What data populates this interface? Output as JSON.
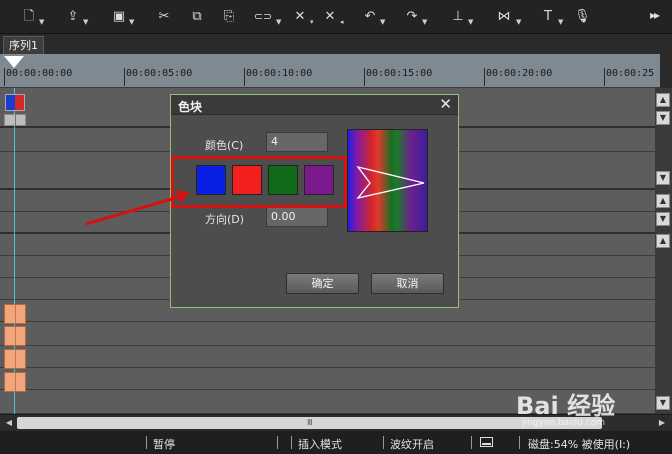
{
  "toolbar": {
    "buttons": [
      {
        "icon": "new-file-icon",
        "glyph": "🗋"
      },
      {
        "icon": "open-icon",
        "glyph": "⇪"
      },
      {
        "icon": "save-icon",
        "glyph": "▣"
      },
      {
        "icon": "cut-icon",
        "glyph": "✂"
      },
      {
        "icon": "copy-icon",
        "glyph": "⧉"
      },
      {
        "icon": "paste-icon",
        "glyph": "⎘"
      },
      {
        "icon": "link-icon",
        "glyph": "⊂⊃"
      },
      {
        "icon": "delete-icon",
        "glyph": "✕"
      },
      {
        "icon": "ripple-delete-icon",
        "glyph": "✕"
      },
      {
        "icon": "undo-icon",
        "glyph": "↶"
      },
      {
        "icon": "redo-icon",
        "glyph": "↷"
      },
      {
        "icon": "mark-icon",
        "glyph": "⊥"
      },
      {
        "icon": "trim-icon",
        "glyph": "⋈"
      },
      {
        "icon": "title-icon",
        "glyph": "T"
      },
      {
        "icon": "voiceover-icon",
        "glyph": "🎙"
      }
    ],
    "more_icon": "more-icon"
  },
  "sequence_tab": "序列1",
  "ruler": {
    "labels": [
      "00:00:00:00",
      "00:00:05:00",
      "00:00:10:00",
      "00:00:15:00",
      "00:00:20:00",
      "00:00:25"
    ]
  },
  "dialog": {
    "title": "色块",
    "color_label": "颜色(C)",
    "color_value": "4",
    "direction_label": "方向(D)",
    "direction_value": "0.00",
    "swatches": [
      "#0a1fe6",
      "#f41f1f",
      "#0f6b1a",
      "#7b1a8c"
    ],
    "ok_label": "确定",
    "cancel_label": "取消"
  },
  "statusbar": {
    "pause": "暂停",
    "insert_mode": "插入模式",
    "ripple_on": "波纹开启",
    "disk": "磁盘:54% 被使用(I:)"
  },
  "watermark": {
    "logo": "Bai 经验",
    "site": "jingyan.baidu.com"
  },
  "colors": {
    "highlight": "#d81010",
    "playhead": "#4ad4ff",
    "dialog_border": "#92c07a"
  }
}
